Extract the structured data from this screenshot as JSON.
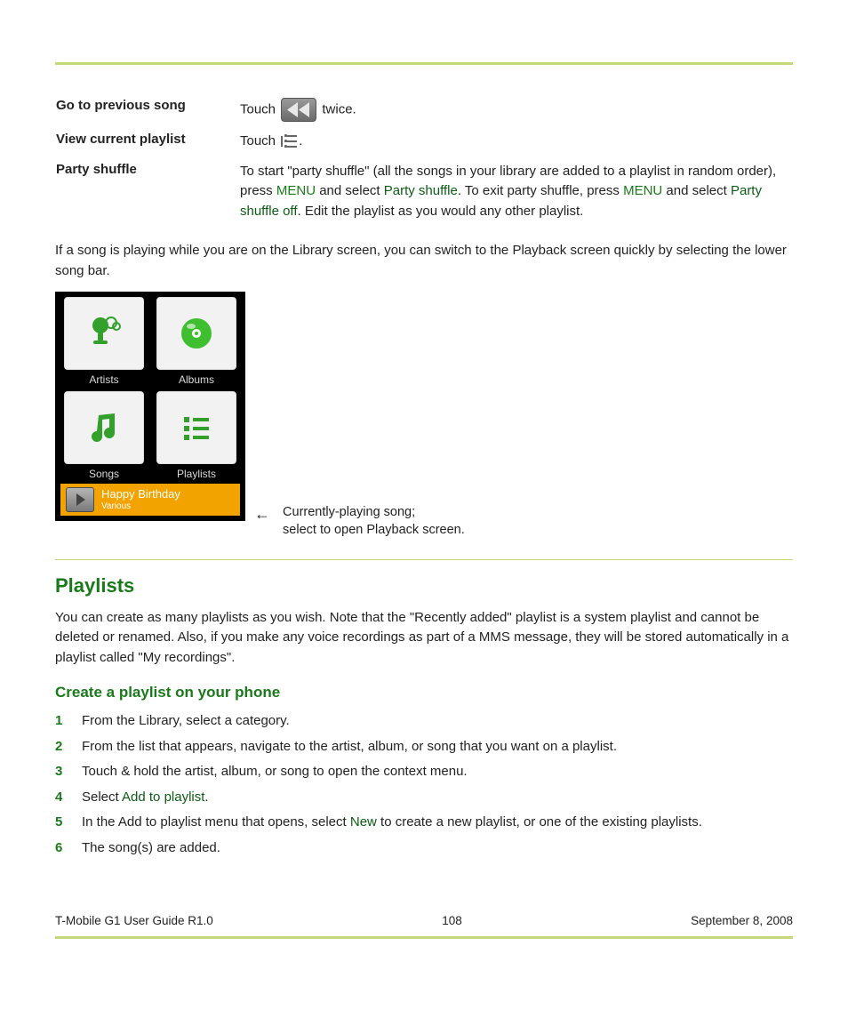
{
  "definitions": {
    "prev_song_term": "Go to previous song",
    "prev_song_desc_pre": "Touch",
    "prev_song_desc_post": "twice.",
    "view_playlist_term": "View current playlist",
    "view_playlist_desc_pre": "Touch",
    "view_playlist_desc_post": ".",
    "party_shuffle_term": "Party shuffle",
    "party_shuffle_p1": "To start \"party shuffle\" (all the songs in your library are added to a playlist in random order), press ",
    "party_shuffle_menu1": "MENU",
    "party_shuffle_p2": " and select ",
    "party_shuffle_link1": "Party shuffle",
    "party_shuffle_p3": ". To exit party shuffle, press ",
    "party_shuffle_menu2": "MENU",
    "party_shuffle_p4": " and select ",
    "party_shuffle_link2": "Party shuffle off",
    "party_shuffle_p5": ". Edit the playlist as you would any other playlist."
  },
  "bridge_paragraph": "If a song is playing while you are on the Library screen, you can switch to the Playback screen quickly by selecting the lower song bar.",
  "library": {
    "tiles": {
      "artists": "Artists",
      "albums": "Albums",
      "songs": "Songs",
      "playlists": "Playlists"
    },
    "now_playing_title": "Happy Birthday",
    "now_playing_sub": "Various"
  },
  "callout_line1": "Currently-playing song;",
  "callout_line2": "select to open Playback screen.",
  "playlists": {
    "heading": "Playlists",
    "intro": "You can create as many playlists as you wish. Note that the \"Recently added\" playlist is a system playlist and cannot be deleted or renamed. Also, if you make any voice recordings as part of a MMS message, they will be stored automatically in a playlist called \"My recordings\".",
    "subheading": "Create a playlist on your phone",
    "steps": [
      "From the Library, select a category.",
      "From the list that appears, navigate to the artist, album, or song that you want on a playlist.",
      "Touch & hold the artist, album, or song to open the context menu.",
      {
        "pre": "Select ",
        "link": "Add to playlist",
        "post": "."
      },
      {
        "pre": "In the Add to playlist menu that opens, select ",
        "link": "New",
        "post": " to create a new playlist, or one of the existing playlists."
      },
      "The song(s) are added."
    ]
  },
  "footer": {
    "left": "T-Mobile G1 User Guide R1.0",
    "center": "108",
    "right": "September 8, 2008"
  }
}
